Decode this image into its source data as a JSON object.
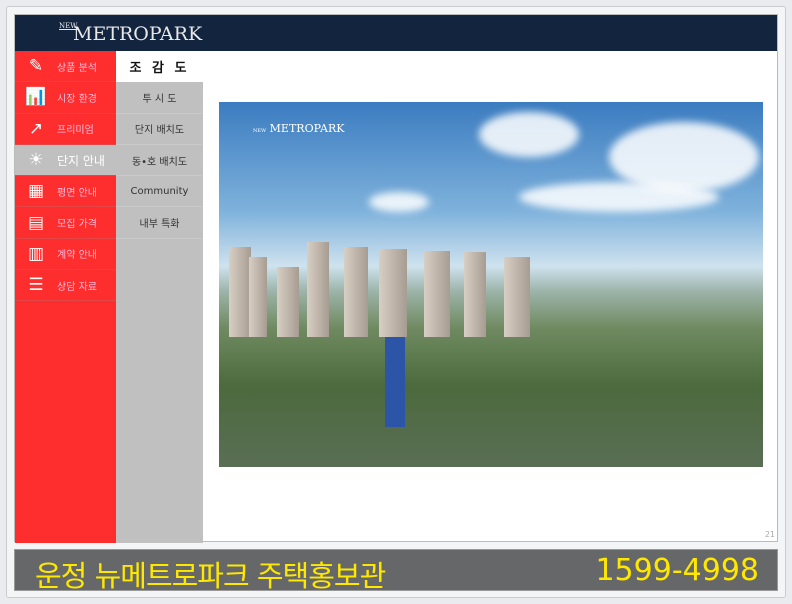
{
  "header": {
    "logo_small": "NEW",
    "logo": "METROPARK"
  },
  "sidebar": {
    "items": [
      {
        "label": "상품 분석",
        "icon": "pen-paper-icon"
      },
      {
        "label": "시장 환경",
        "icon": "chart-search-icon"
      },
      {
        "label": "프리미엄",
        "icon": "growth-chart-icon"
      },
      {
        "label": "단지 안내",
        "icon": "person-building-icon",
        "active": true
      },
      {
        "label": "평면 안내",
        "icon": "floorplan-icon"
      },
      {
        "label": "모집 가격",
        "icon": "price-table-icon"
      },
      {
        "label": "계약 안내",
        "icon": "calendar-icon"
      },
      {
        "label": "상담 자료",
        "icon": "notepad-icon"
      }
    ]
  },
  "subnav": {
    "items": [
      "조 감 도",
      "투 시 도",
      "단지 배치도",
      "동•호 배치도",
      "Community",
      "내부 특화"
    ]
  },
  "photo": {
    "logo_small": "NEW",
    "logo": "METROPARK"
  },
  "page_number": "21",
  "banner": {
    "title": "운정 뉴메트로파크 주택홍보관",
    "phone": "1599-4998"
  },
  "colors": {
    "header": "#13243f",
    "sidebar": "#fe2e2e",
    "subnav": "#c0c0c0",
    "banner_text": "#ffe800"
  }
}
